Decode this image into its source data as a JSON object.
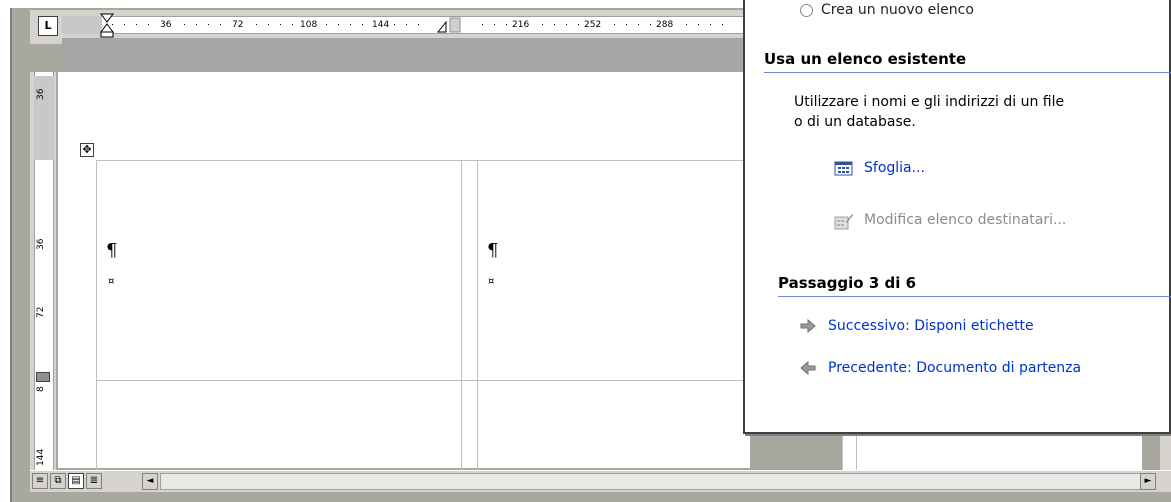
{
  "ruler": {
    "corner_label": "L",
    "top_numbers": [
      "36",
      "72",
      "108",
      "144",
      "216",
      "252",
      "288"
    ],
    "left_numbers": [
      "36",
      "36",
      "72",
      "8",
      "144"
    ]
  },
  "document": {
    "pilcrow": "¶",
    "cell_marker": "¤",
    "table_handle": "✥"
  },
  "view_bar": {
    "buttons": [
      "≡",
      "⧉",
      "▤",
      "≣"
    ],
    "scroll_left": "◄",
    "scroll_right": "►"
  },
  "task_pane": {
    "radio_label": "Crea un nuovo elenco",
    "section_existing": "Usa un elenco esistente",
    "description_line1": "Utilizzare i nomi e gli indirizzi di un file",
    "description_line2": "o di un database.",
    "browse_link": "Sfoglia...",
    "edit_link": "Modifica elenco destinatari...",
    "step_heading": "Passaggio 3 di 6",
    "next_link": "Successivo: Disponi etichette",
    "prev_link": "Precedente: Documento di partenza"
  },
  "colors": {
    "link": "#0033cc",
    "disabled": "#8c8c8c",
    "rule": "#6a8ad0",
    "chrome": "#d6d3ce"
  }
}
